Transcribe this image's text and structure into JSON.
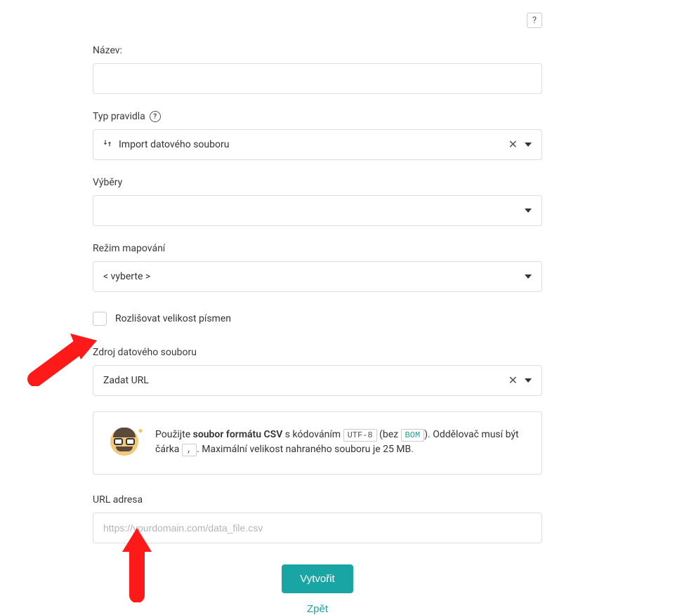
{
  "help_icon": "?",
  "fields": {
    "name": {
      "label": "Název:",
      "value": ""
    },
    "rule_type": {
      "label": "Typ pravidla",
      "value": "Import datového souboru",
      "clearable": true
    },
    "selections": {
      "label": "Výběry",
      "value": ""
    },
    "mapping_mode": {
      "label": "Režim mapování",
      "value": "< vyberte >"
    },
    "case_sensitive": {
      "label": "Rozlišovat velikost písmen",
      "checked": false
    },
    "data_source": {
      "label": "Zdroj datového souboru",
      "value": "Zadat URL",
      "clearable": true
    },
    "url_address": {
      "label": "URL adresa",
      "placeholder": "https://yourdomain.com/data_file.csv",
      "value": ""
    }
  },
  "info": {
    "pre": "Použijte ",
    "bold": "soubor formátu CSV",
    "mid1": " s kódováním ",
    "badge1": "UTF-8",
    "mid2": " (bez ",
    "badge2": "BOM",
    "mid3": "). Oddělovač musí být čárka ",
    "badge3": ",",
    "post": ". Maximální velikost nahraného souboru je 25 MB."
  },
  "actions": {
    "create": "Vytvořit",
    "back": "Zpět"
  }
}
